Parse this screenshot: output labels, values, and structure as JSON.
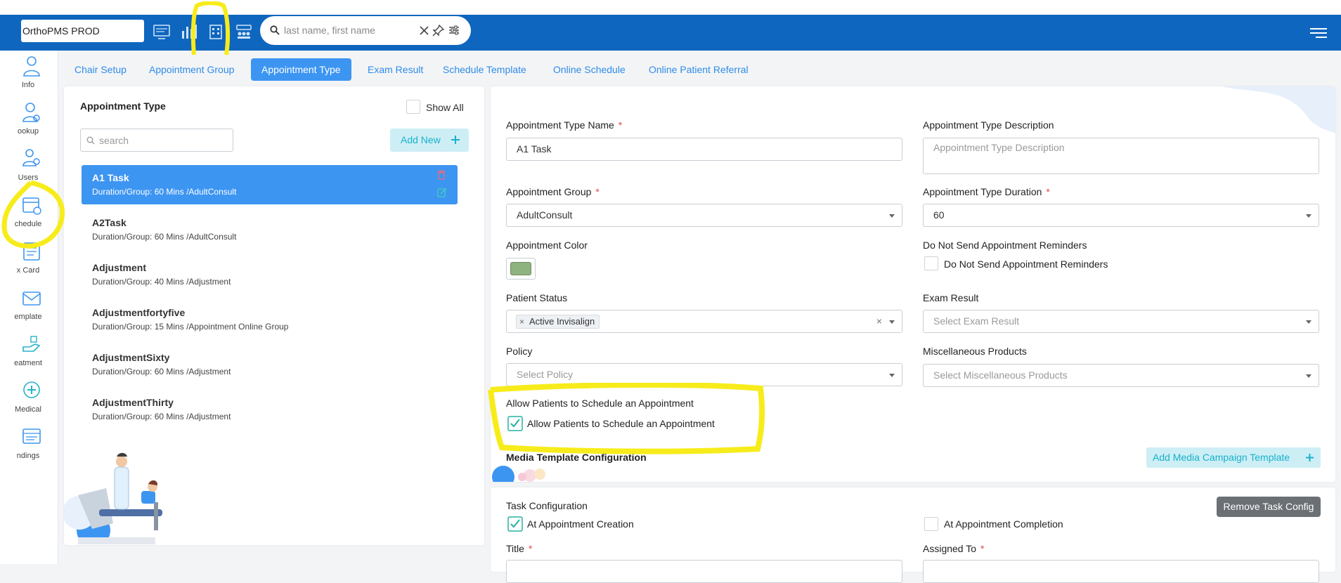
{
  "topbar": {
    "env_label": "OrthoPMS PROD",
    "search_placeholder": "last name, first name"
  },
  "sidebar": {
    "items": [
      {
        "label": "Info",
        "icon": "person-icon"
      },
      {
        "label": "ookup",
        "icon": "doctor-search-icon"
      },
      {
        "label": "Users",
        "icon": "users-icon"
      },
      {
        "label": "chedule",
        "icon": "calendar-icon"
      },
      {
        "label": "x Card",
        "icon": "card-icon"
      },
      {
        "label": "emplate",
        "icon": "envelope-icon"
      },
      {
        "label": "eatment",
        "icon": "hand-icon"
      },
      {
        "label": "Medical",
        "icon": "medical-icon"
      },
      {
        "label": "ndings",
        "icon": "findings-icon"
      }
    ]
  },
  "tabs": [
    {
      "label": "Chair Setup"
    },
    {
      "label": "Appointment Group"
    },
    {
      "label": "Appointment Type"
    },
    {
      "label": "Exam Result"
    },
    {
      "label": "Schedule Template"
    },
    {
      "label": "Online Schedule"
    },
    {
      "label": "Online Patient Referral"
    }
  ],
  "left_panel": {
    "title": "Appointment Type",
    "show_all_label": "Show All",
    "search_placeholder": "search",
    "add_new_label": "Add New",
    "items": [
      {
        "name": "A1 Task",
        "detail": "Duration/Group: 60 Mins /AdultConsult"
      },
      {
        "name": "A2Task",
        "detail": "Duration/Group: 60 Mins /AdultConsult"
      },
      {
        "name": "Adjustment",
        "detail": "Duration/Group: 40 Mins /Adjustment"
      },
      {
        "name": "Adjustmentfortyfive",
        "detail": "Duration/Group: 15 Mins /Appointment Online Group"
      },
      {
        "name": "AdjustmentSixty",
        "detail": "Duration/Group: 60 Mins /Adjustment"
      },
      {
        "name": "AdjustmentThirty",
        "detail": "Duration/Group: 60 Mins /Adjustment"
      }
    ]
  },
  "form": {
    "type_name_label": "Appointment Type Name",
    "type_name_value": "A1 Task",
    "type_desc_label": "Appointment Type Description",
    "type_desc_placeholder": "Appointment Type Description",
    "group_label": "Appointment Group",
    "group_value": "AdultConsult",
    "duration_label": "Appointment Type Duration",
    "duration_value": "60",
    "color_label": "Appointment Color",
    "color_value": "#8fb37f",
    "no_reminders_label": "Do Not Send Appointment Reminders",
    "no_reminders_checkbox": "Do Not Send Appointment Reminders",
    "patient_status_label": "Patient Status",
    "patient_status_tag": "Active Invisalign",
    "exam_result_label": "Exam Result",
    "exam_result_placeholder": "Select Exam Result",
    "policy_label": "Policy",
    "policy_placeholder": "Select Policy",
    "misc_label": "Miscellaneous Products",
    "misc_placeholder": "Select Miscellaneous Products",
    "allow_label": "Allow Patients to Schedule an Appointment",
    "allow_checkbox": "Allow Patients to Schedule an Appointment",
    "media_label": "Media Template Configuration",
    "add_media_label": "Add Media Campaign Template",
    "required_mark": "*"
  },
  "task": {
    "title": "Task Configuration",
    "remove_label": "Remove Task Config",
    "at_creation": "At Appointment Creation",
    "at_completion": "At Appointment Completion",
    "title_label": "Title",
    "assigned_label": "Assigned To"
  },
  "colors": {
    "brand_blue": "#0f66be",
    "tab_active": "#3d95f2",
    "accent_teal": "#18b1cc",
    "highlight": "#f7ec1b"
  }
}
